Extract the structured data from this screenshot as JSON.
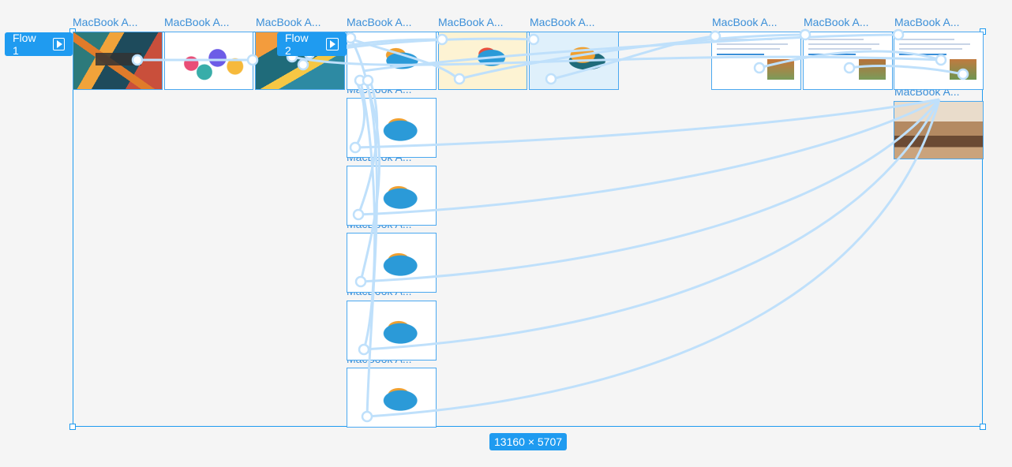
{
  "flows": [
    {
      "label": "Flow 1"
    },
    {
      "label": "Flow 2"
    }
  ],
  "frames": [
    {
      "label": "MacBook A...",
      "theme": "map-dark"
    },
    {
      "label": "MacBook A...",
      "theme": "city-white"
    },
    {
      "label": "MacBook A...",
      "theme": "map-dark"
    },
    {
      "label": "MacBook A...",
      "theme": "page-city"
    },
    {
      "label": "MacBook A...",
      "theme": "page-yellow"
    },
    {
      "label": "MacBook A...",
      "theme": "page-blue"
    },
    {
      "label": "MacBook A...",
      "theme": "doc-house"
    },
    {
      "label": "MacBook A...",
      "theme": "doc-house"
    },
    {
      "label": "MacBook A...",
      "theme": "doc-house"
    },
    {
      "label": "MacBook A...",
      "theme": "photo-room"
    },
    {
      "label": "MacBook A...",
      "theme": "page-city"
    },
    {
      "label": "MacBook A...",
      "theme": "page-city"
    },
    {
      "label": "MacBook A...",
      "theme": "page-city"
    },
    {
      "label": "MacBook A...",
      "theme": "page-city"
    },
    {
      "label": "MacBook A...",
      "theme": "page-city"
    }
  ],
  "selection_size": "13160 × 5707",
  "colors": {
    "accent": "#1f9bf0",
    "link": "#bfe0fb",
    "canvas": "#f5f5f5"
  }
}
